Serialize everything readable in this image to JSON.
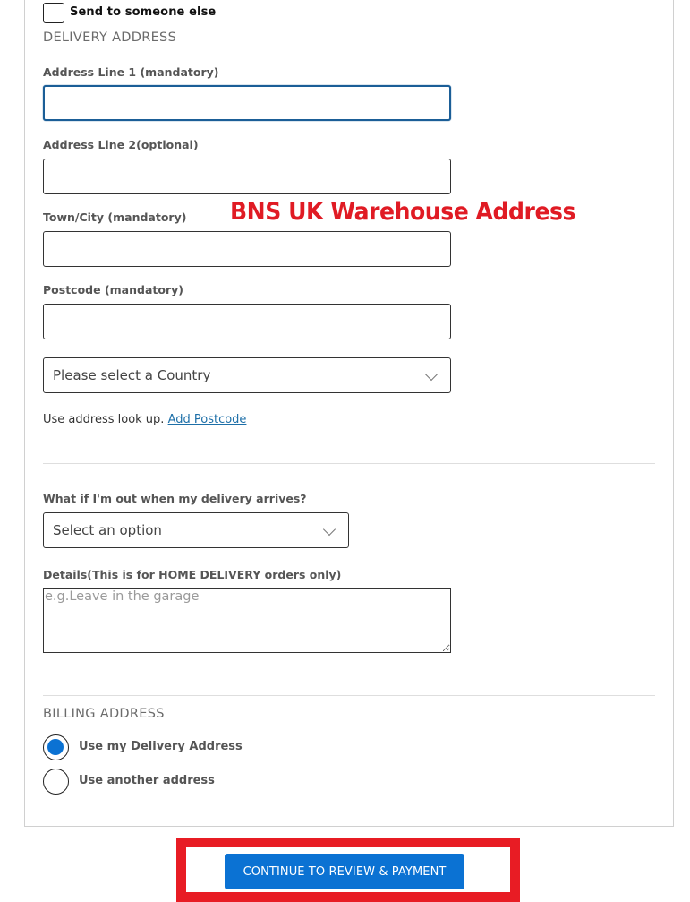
{
  "send_to_someone_else": {
    "label": "Send to someone else",
    "checked": false
  },
  "delivery_address": {
    "section_title": "DELIVERY ADDRESS",
    "address_line_1": {
      "label": "Address Line 1 (mandatory)",
      "value": ""
    },
    "address_line_2": {
      "label": "Address Line 2(optional)",
      "value": ""
    },
    "town_city": {
      "label": "Town/City (mandatory)",
      "value": ""
    },
    "postcode": {
      "label": "Postcode (mandatory)",
      "value": ""
    },
    "country_select": {
      "selected": "Please select a Country"
    },
    "lookup": {
      "text": "Use address look up.",
      "link": "Add Postcode"
    }
  },
  "annotation": {
    "text": "BNS UK Warehouse Address",
    "color": "#e01b24"
  },
  "delivery_options": {
    "question_label": "What if I'm out when my delivery arrives?",
    "option_select": {
      "selected": "Select an option"
    },
    "details_label": "Details(This is for HOME DELIVERY orders only)",
    "details_placeholder": "e.g.Leave in the garage",
    "details_value": ""
  },
  "billing_address": {
    "section_title": "BILLING ADDRESS",
    "options": [
      {
        "label": "Use my Delivery Address",
        "checked": true
      },
      {
        "label": "Use another address",
        "checked": false
      }
    ]
  },
  "continue_button": {
    "label": "CONTINUE TO REVIEW & PAYMENT",
    "color": "#0b72d3"
  },
  "highlight_box_color": "#e81c24"
}
